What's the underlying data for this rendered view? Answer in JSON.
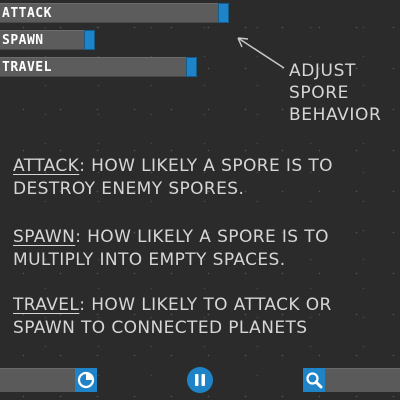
{
  "sliders": [
    {
      "id": "attack",
      "label": "ATTACK",
      "value_fraction": 0.57
    },
    {
      "id": "spawn",
      "label": "SPAWN",
      "value_fraction": 0.24
    },
    {
      "id": "travel",
      "label": "TRAVEL",
      "value_fraction": 0.49
    }
  ],
  "callout": {
    "line1": "ADJUST",
    "line2": "SPORE",
    "line3": "BEHAVIOR"
  },
  "descriptions": {
    "attack": {
      "term": "ATTACK",
      "line1_rest": ": HOW LIKELY A SPORE IS TO",
      "line2": "DESTROY ENEMY SPORES."
    },
    "spawn": {
      "term": "SPAWN",
      "line1_rest": ": HOW LIKELY A SPORE IS TO",
      "line2": "MULTIPLY INTO EMPTY SPACES."
    },
    "travel": {
      "term": "TRAVEL",
      "line1_rest": ": HOW LIKELY TO ATTACK OR",
      "line2": "SPAWN TO CONNECTED PLANETS"
    }
  },
  "toolbar": {
    "buttons": [
      {
        "name": "timer",
        "icon": "timer-icon"
      },
      {
        "name": "pause",
        "icon": "pause-icon"
      },
      {
        "name": "zoom",
        "icon": "magnifier-icon"
      }
    ]
  },
  "colors": {
    "background": "#2b2b2c",
    "slider_track": "#5c5c5c",
    "accent_blue": "#1f84c7",
    "text": "#d6d6d6"
  }
}
